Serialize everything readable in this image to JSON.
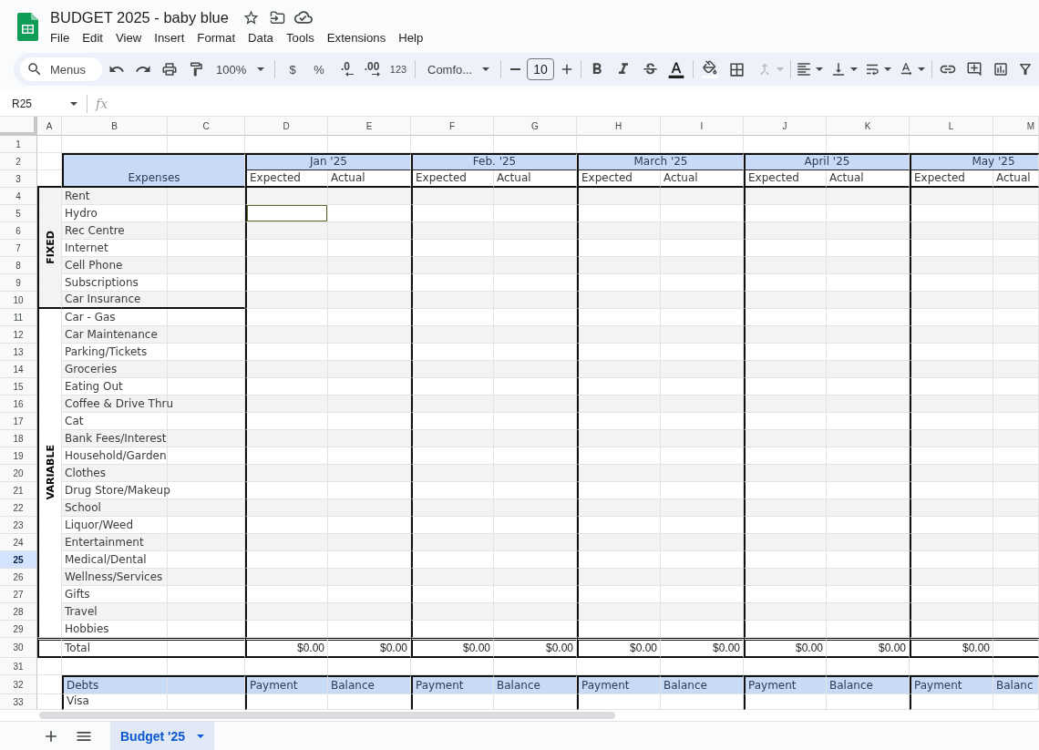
{
  "document": {
    "title": "BUDGET 2025 - baby blue",
    "starred": false
  },
  "menu": [
    "File",
    "Edit",
    "View",
    "Insert",
    "Format",
    "Data",
    "Tools",
    "Extensions",
    "Help"
  ],
  "toolbar": {
    "search": {
      "placeholder": "Menus"
    },
    "zoom": "100%",
    "format_buttons": [
      {
        "kind": "currency",
        "label": "$"
      },
      {
        "kind": "percent",
        "label": "%"
      },
      {
        "kind": "decrease_decimals",
        "label": ".0"
      },
      {
        "kind": "increase_decimals",
        "label": ".00"
      },
      {
        "kind": "more_formats",
        "label": "123"
      }
    ],
    "font": "Comfo...",
    "font_size": "10",
    "merge": {
      "disabled": true
    }
  },
  "formula_bar": {
    "name_box": "R25",
    "function_label": "fx"
  },
  "sheet": {
    "columns": [
      {
        "label": "A",
        "selected": false
      },
      {
        "label": "B",
        "selected": false
      },
      {
        "label": "C",
        "selected": false
      },
      {
        "label": "D",
        "selected": false
      },
      {
        "label": "E",
        "selected": false
      },
      {
        "label": "F",
        "selected": false
      },
      {
        "label": "G",
        "selected": false
      },
      {
        "label": "H",
        "selected": false
      },
      {
        "label": "I",
        "selected": false
      },
      {
        "label": "J",
        "selected": false
      },
      {
        "label": "K",
        "selected": false
      },
      {
        "label": "L",
        "selected": false
      },
      {
        "label": "M",
        "selected": false
      }
    ],
    "rows": [
      {
        "label": "1",
        "selected": false
      },
      {
        "label": "2",
        "selected": false
      },
      {
        "label": "3",
        "selected": false
      },
      {
        "label": "4",
        "selected": false
      },
      {
        "label": "5",
        "selected": false
      },
      {
        "label": "6",
        "selected": false
      },
      {
        "label": "7",
        "selected": false
      },
      {
        "label": "8",
        "selected": false
      },
      {
        "label": "9",
        "selected": false
      },
      {
        "label": "10",
        "selected": false
      },
      {
        "label": "11",
        "selected": false
      },
      {
        "label": "12",
        "selected": false
      },
      {
        "label": "13",
        "selected": false
      },
      {
        "label": "14",
        "selected": false
      },
      {
        "label": "15",
        "selected": false
      },
      {
        "label": "16",
        "selected": false
      },
      {
        "label": "17",
        "selected": false
      },
      {
        "label": "18",
        "selected": false
      },
      {
        "label": "19",
        "selected": false
      },
      {
        "label": "20",
        "selected": false
      },
      {
        "label": "21",
        "selected": false
      },
      {
        "label": "22",
        "selected": false
      },
      {
        "label": "23",
        "selected": false
      },
      {
        "label": "24",
        "selected": false
      },
      {
        "label": "25",
        "selected": true
      },
      {
        "label": "26",
        "selected": false
      },
      {
        "label": "27",
        "selected": false
      },
      {
        "label": "28",
        "selected": false
      },
      {
        "label": "29",
        "selected": false
      },
      {
        "label": "30",
        "selected": false
      },
      {
        "label": "31",
        "selected": false
      },
      {
        "label": "32",
        "selected": false
      },
      {
        "label": "33",
        "selected": false
      }
    ],
    "expenses_header": "Expenses",
    "months": [
      {
        "name": "Jan '25",
        "expected": "Expected",
        "actual": "Actual",
        "total_expected": "$0.00",
        "total_actual": "$0.00",
        "payment": "Payment",
        "balance": "Balance"
      },
      {
        "name": "Feb. '25",
        "expected": "Expected",
        "actual": "Actual",
        "total_expected": "$0.00",
        "total_actual": "$0.00",
        "payment": "Payment",
        "balance": "Balance"
      },
      {
        "name": "March '25",
        "expected": "Expected",
        "actual": "Actual",
        "total_expected": "$0.00",
        "total_actual": "$0.00",
        "payment": "Payment",
        "balance": "Balance"
      },
      {
        "name": "April '25",
        "expected": "Expected",
        "actual": "Actual",
        "total_expected": "$0.00",
        "total_actual": "$0.00",
        "payment": "Payment",
        "balance": "Balance"
      },
      {
        "name": "May '25",
        "expected": "Expected",
        "actual": "Actual",
        "total_expected": "$0.00",
        "payment": "Payment",
        "balance": "Balanc"
      }
    ],
    "groups": [
      {
        "label": "FIXED",
        "items": [
          "Rent",
          "Hydro",
          "Rec Centre",
          "Internet",
          "Cell Phone",
          "Subscriptions",
          "Car Insurance"
        ]
      },
      {
        "label": "VARIABLE",
        "items": [
          "Car - Gas",
          "Car Maintenance",
          "Parking/Tickets",
          "Groceries",
          "Eating Out",
          "Coffee & Drive Thru",
          "Cat",
          "Bank Fees/Interest",
          "Household/Garden",
          "Clothes",
          "Drug Store/Makeup",
          "School",
          "Liquor/Weed",
          "Entertainment",
          "Medical/Dental",
          "Wellness/Services",
          "Gifts",
          "Travel",
          "Hobbies"
        ]
      }
    ],
    "total_label": "Total",
    "debts_header": "Debts",
    "debts": [
      "Visa"
    ]
  },
  "sheet_tabs": [
    {
      "label": "Budget '25",
      "selected": true
    }
  ]
}
